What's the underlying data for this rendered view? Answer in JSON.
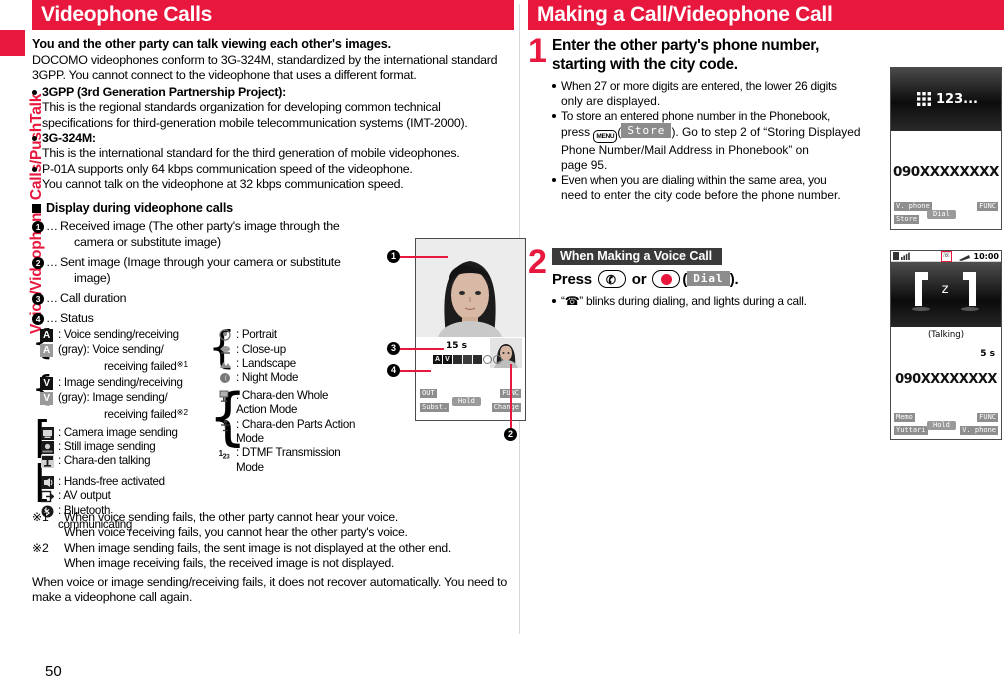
{
  "sidebar": {
    "label": "Voice/Videophone Calls/PushTalk"
  },
  "page_number": "50",
  "colors": {
    "accent_red": "#e8173d",
    "tag_gray": "#3a3a3a",
    "soft_gray": "#8e8e8e"
  },
  "left": {
    "header": "Videophone Calls",
    "lead": "You and the other party can talk viewing each other's images.",
    "intro": "DOCOMO videophones conform to 3G-324M, standardized by the international standard 3GPP. You cannot connect to the videophone that uses a different format.",
    "bullets": [
      {
        "bold_label": "3GPP (3rd Generation Partnership Project):",
        "body": "This is the regional standards organization for developing common technical specifications for third-generation mobile telecommunication systems (IMT-2000)."
      },
      {
        "bold_label": "3G-324M:",
        "body": "This is the international standard for the third generation of mobile videophones."
      },
      {
        "bold_label": "",
        "body": "P-01A supports only 64 kbps communication speed of the videophone.",
        "body2": "You cannot talk on the videophone at 32 kbps communication speed."
      }
    ],
    "subhead": "Display during videophone calls",
    "callouts": [
      {
        "num": "1",
        "text": "Received image (The other party's image through the",
        "text2": "camera or substitute image)"
      },
      {
        "num": "2",
        "text": "Sent image (Image through your camera or substitute",
        "text2": "image)"
      },
      {
        "num": "3",
        "text": "Call duration",
        "text2": ""
      },
      {
        "num": "4",
        "text": "Status",
        "text2": ""
      }
    ],
    "legend_left": [
      {
        "icon": "A",
        "icon_kind": "chip-dark",
        "label": ": Voice sending/receiving",
        "cont": ""
      },
      {
        "icon": "A",
        "icon_kind": "chip-gray",
        "label": "(gray): Voice sending/",
        "cont": "receiving failed",
        "cont_sup": "※1"
      },
      {
        "icon": "V",
        "icon_kind": "chip-dark",
        "label": ": Image sending/receiving",
        "cont": ""
      },
      {
        "icon": "V",
        "icon_kind": "chip-gray",
        "label": "(gray): Image sending/",
        "cont": "receiving failed",
        "cont_sup": "※2"
      },
      {
        "icon": "⬛",
        "icon_kind": "glyph-camera",
        "label": ": Camera image sending",
        "cont": ""
      },
      {
        "icon": "⬛",
        "icon_kind": "glyph-still",
        "label": ": Still image sending",
        "cont": ""
      },
      {
        "icon": "⬛",
        "icon_kind": "glyph-chara",
        "label": ": Chara-den talking",
        "cont": ""
      },
      {
        "icon": "⬛",
        "icon_kind": "glyph-hands",
        "label": ": Hands-free activated",
        "cont": ""
      },
      {
        "icon": "⬛",
        "icon_kind": "glyph-av",
        "label": ": AV output",
        "cont": ""
      },
      {
        "icon": "⬛",
        "icon_kind": "glyph-bt",
        "label": ": Bluetooth",
        "cont": "communicating"
      }
    ],
    "legend_right": [
      {
        "icon": "◔",
        "icon_kind": "glyph-portrait",
        "label": ": Portrait",
        "cont": ""
      },
      {
        "icon": "◔",
        "icon_kind": "glyph-closeup",
        "label": ": Close-up",
        "cont": ""
      },
      {
        "icon": "◔",
        "icon_kind": "glyph-landscape",
        "label": ": Landscape",
        "cont": ""
      },
      {
        "icon": "◔",
        "icon_kind": "glyph-night",
        "label": ": Night Mode",
        "cont": ""
      },
      {
        "icon": "◔",
        "icon_kind": "glyph-whole",
        "label": ": Chara-den Whole",
        "cont": "Action Mode"
      },
      {
        "icon": "◔",
        "icon_kind": "glyph-parts",
        "label": ": Chara-den Parts Action",
        "cont": "Mode"
      },
      {
        "icon": "123",
        "icon_kind": "glyph-dtmf",
        "label": ": DTMF Transmission",
        "cont": "Mode"
      }
    ],
    "footnotes": [
      {
        "mark": "※1",
        "line1": "When voice sending fails, the other party cannot hear your voice.",
        "line2": "When voice receiving fails, you cannot hear the other party's voice."
      },
      {
        "mark": "※2",
        "line1": "When image sending fails, the sent image is not displayed at the other end.",
        "line2": "When image receiving fails, the received image is not displayed."
      }
    ],
    "closing": "When voice or image sending/receiving fails, it does not recover automatically. You need to make a videophone call again.",
    "phone_screen": {
      "duration": "15 s",
      "soft_left_top": "OUT",
      "soft_left_bottom": "Subst.",
      "soft_right_top": "FUNC",
      "soft_right_bottom": "Change",
      "dpad": "Hold"
    }
  },
  "right": {
    "header": "Making a Call/Videophone Call",
    "steps": [
      {
        "num": "1",
        "title": "Enter the other party's phone number, starting with the city code.",
        "bullets": [
          {
            "line1": "When 27 or more digits are entered, the lower 26 digits",
            "line2": "only are displayed."
          },
          {
            "line1": "To store an entered phone number in the Phonebook,",
            "pre": "press ",
            "menukey": "MENU",
            "softtag": "Store",
            "post": "). Go to step 2 of “Storing Displayed",
            "line3": "Phone Number/Mail Address in Phonebook” on",
            "line4": "page 95."
          },
          {
            "line1": "Even when you are dialing within the same area, you",
            "line2": "need to enter the city code before the phone number."
          }
        ],
        "phone_screen": {
          "top_label": "123...",
          "number": "090XXXXXXXX",
          "soft_left_top": "V. phone",
          "soft_left_bottom": "Store",
          "soft_right_top": "FUNC",
          "dpad": "Dial"
        }
      },
      {
        "num": "2",
        "tag": "When Making a Voice Call",
        "press_pre": "Press ",
        "press_mid": " or ",
        "press_softtag": "Dial",
        "press_post": ").",
        "bullets": [
          {
            "line1": "“☎” blinks during dialing, and lights during a call."
          }
        ],
        "phone_screen": {
          "status_time": "10:00",
          "talking": "(Talking)",
          "duration": "5 s",
          "number": "090XXXXXXXX",
          "soft_left_top": "Memo",
          "soft_left_bottom": "Yuttari",
          "soft_right_top": "FUNC",
          "soft_right_bottom": "V. phone",
          "dpad": "Hold"
        }
      }
    ]
  }
}
